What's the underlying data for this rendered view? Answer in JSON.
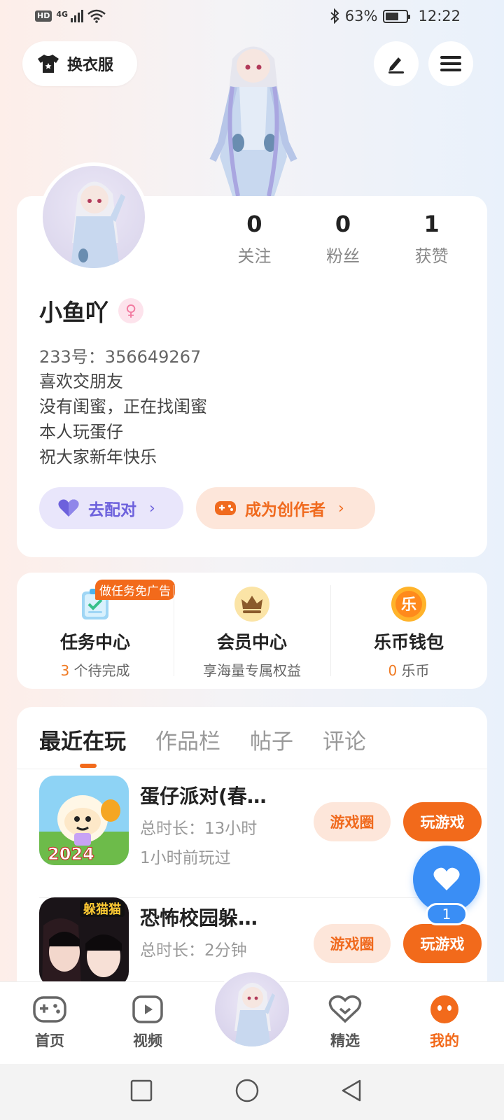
{
  "status_bar": {
    "hd": "HD",
    "signal": "4G",
    "battery_pct": "63%",
    "time": "12:22"
  },
  "header": {
    "wardrobe_label": "换衣服"
  },
  "profile": {
    "stats": [
      {
        "value": "0",
        "label": "关注"
      },
      {
        "value": "0",
        "label": "粉丝"
      },
      {
        "value": "1",
        "label": "获赞"
      }
    ],
    "name": "小鱼吖",
    "gender_symbol": "♀",
    "uid": "233号：356649267",
    "bio": [
      "喜欢交朋友",
      "没有闺蜜，正在找闺蜜",
      "本人玩蛋仔",
      "祝大家新年快乐"
    ],
    "pair_button": "去配对",
    "creator_button": "成为创作者"
  },
  "services": {
    "task": {
      "title": "任务中心",
      "badge": "做任务免广告",
      "count": "3",
      "sub": " 个待完成"
    },
    "vip": {
      "title": "会员中心",
      "sub": "享海量专属权益"
    },
    "wallet": {
      "title": "乐币钱包",
      "count": "0",
      "sub": " 乐币",
      "coin_char": "乐"
    }
  },
  "tabs": [
    "最近在玩",
    "作品栏",
    "帖子",
    "评论"
  ],
  "games": [
    {
      "title": "蛋仔派对(春…",
      "duration": "总时长：13小时",
      "last_played": "1小时前玩过",
      "circle_btn": "游戏圈",
      "play_btn": "玩游戏",
      "thumb_text": "2024"
    },
    {
      "title": "恐怖校园躲…",
      "duration": "总时长：2分钟",
      "circle_btn": "游戏圈",
      "play_btn": "玩游戏",
      "thumb_text": "躲猫猫"
    }
  ],
  "fab": {
    "count": "1"
  },
  "bottom_nav": [
    {
      "label": "首页"
    },
    {
      "label": "视频"
    },
    {
      "label": "精选"
    },
    {
      "label": "我的"
    }
  ],
  "colors": {
    "accent": "#f26a1b",
    "pair": "#6d61dc",
    "fab": "#3a8ef5"
  }
}
